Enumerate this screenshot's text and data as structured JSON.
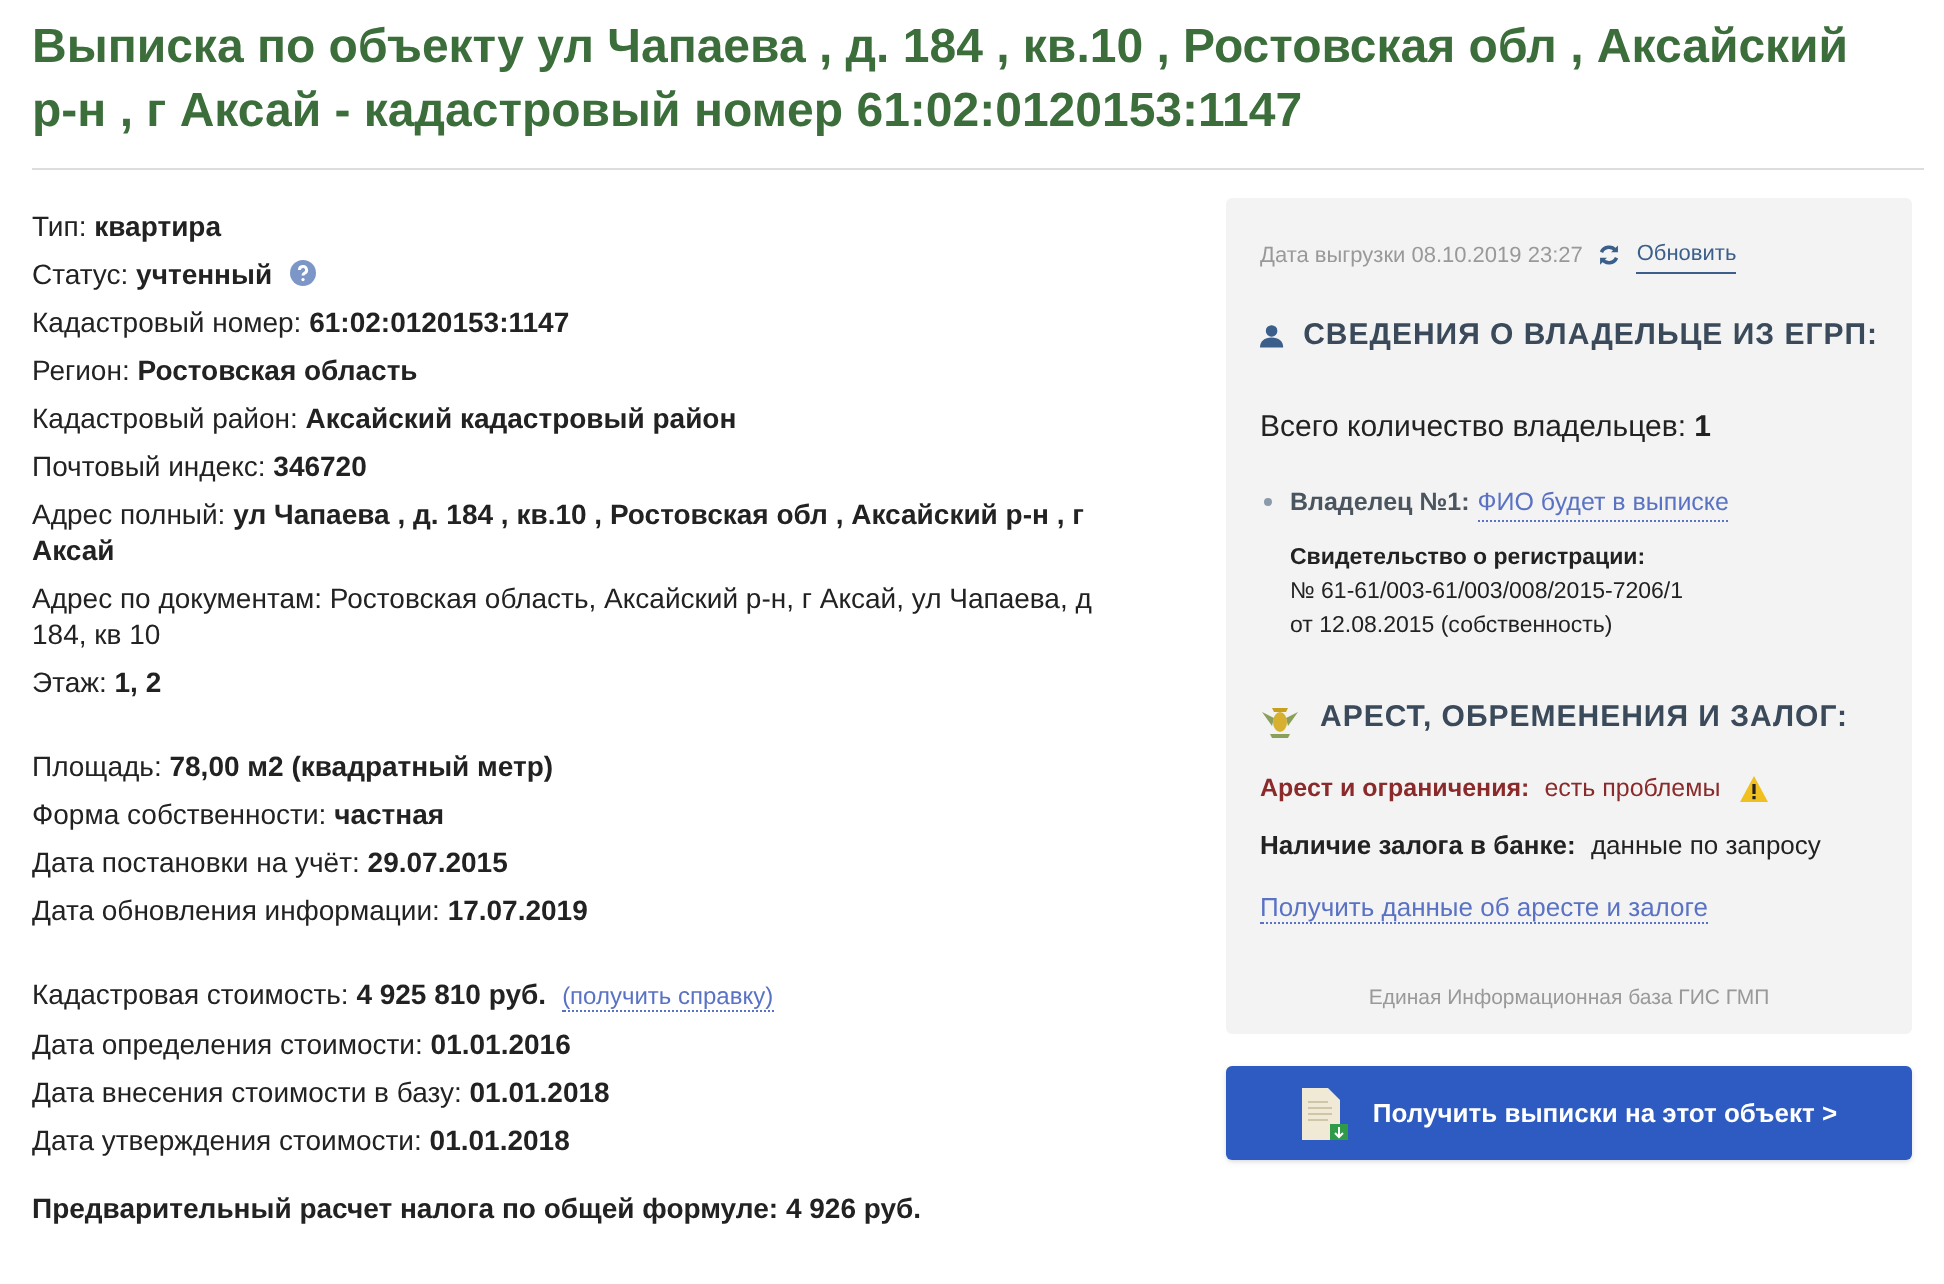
{
  "title": "Выписка по объекту ул Чапаева , д. 184 , кв.10 , Ростовская обл , Аксайский р-н , г Аксай - кадастровый номер 61:02:0120153:1147",
  "groups": [
    [
      {
        "kind": "bold",
        "label": "Тип:",
        "value": "квартира"
      },
      {
        "kind": "help",
        "label": "Статус:",
        "value": "учтенный"
      },
      {
        "kind": "bold",
        "label": "Кадастровый номер:",
        "value": "61:02:0120153:1147"
      },
      {
        "kind": "bold",
        "label": "Регион:",
        "value": "Ростовская область"
      },
      {
        "kind": "bold",
        "label": "Кадастровый район:",
        "value": "Аксайский кадастровый район"
      },
      {
        "kind": "bold",
        "label": "Почтовый индекс:",
        "value": "346720"
      },
      {
        "kind": "bold",
        "label": "Адрес полный:",
        "value": "ул Чапаева , д. 184 , кв.10 , Ростовская обл , Аксайский р-н , г Аксай"
      },
      {
        "kind": "plain",
        "label": "Адрес по документам:",
        "value": "Ростовская область, Аксайский р-н, г Аксай, ул Чапаева, д 184, кв 10"
      },
      {
        "kind": "bold",
        "label": "Этаж:",
        "value": "1, 2"
      }
    ],
    [
      {
        "kind": "bold",
        "label": "Площадь:",
        "value": "78,00 м2 (квадратный метр)"
      },
      {
        "kind": "bold",
        "label": "Форма собственности:",
        "value": "частная"
      },
      {
        "kind": "bold",
        "label": "Дата постановки на учёт:",
        "value": "29.07.2015"
      },
      {
        "kind": "bold",
        "label": "Дата обновления информации:",
        "value": "17.07.2019"
      }
    ],
    [
      {
        "kind": "link",
        "label": "Кадастровая стоимость:",
        "value": "4 925 810 руб.",
        "link": "(получить справку)"
      },
      {
        "kind": "bold",
        "label": "Дата определения стоимости:",
        "value": "01.01.2016"
      },
      {
        "kind": "bold",
        "label": "Дата внесения стоимости в базу:",
        "value": "01.01.2018"
      },
      {
        "kind": "bold",
        "label": "Дата утверждения стоимости:",
        "value": "01.01.2018"
      }
    ]
  ],
  "tax": "Предварительный расчет налога по общей формуле: 4 926 руб.",
  "panel": {
    "export_date": "Дата выгрузки 08.10.2019 23:27",
    "refresh": "Обновить",
    "owners_heading": "СВЕДЕНИЯ О ВЛАДЕЛЬЦЕ ИЗ ЕГРП:",
    "owners_total_label": "Всего количество владельцев:",
    "owners_total": "1",
    "owners": [
      {
        "label": "Владелец №1:",
        "link": "ФИО будет в выписке",
        "cert_label": "Свидетельство о регистрации:",
        "cert_number": "№ 61-61/003-61/003/008/2015-7206/1",
        "cert_date": "от 12.08.2015 (собственность)"
      }
    ],
    "arrest_heading": "АРЕСТ, ОБРЕМЕНЕНИЯ И ЗАЛОГ:",
    "arrest_label": "Арест и ограничения:",
    "arrest_value": "есть проблемы",
    "pledge_label": "Наличие залога в банке:",
    "pledge_value": "данные по запросу",
    "arrest_link": "Получить данные об аресте и залоге",
    "source": "Единая Информационная база ГИС ГМП"
  },
  "button": "Получить выписки на этот объект >"
}
